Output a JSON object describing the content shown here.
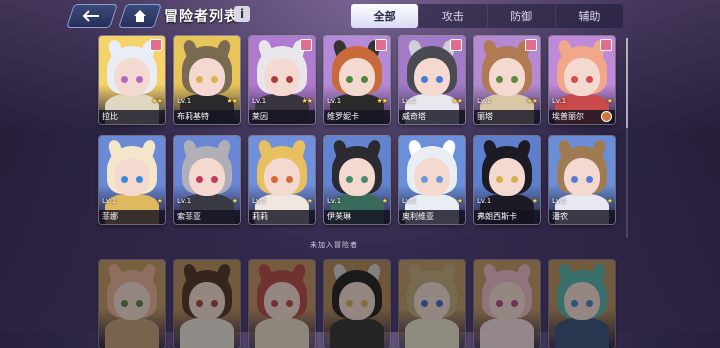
{
  "header": {
    "title": "冒险者列表",
    "info_label": "i"
  },
  "tabs": [
    {
      "label": "全部",
      "active": true
    },
    {
      "label": "攻击",
      "active": false
    },
    {
      "label": "防御",
      "active": false
    },
    {
      "label": "辅助",
      "active": false
    }
  ],
  "owned": [
    {
      "name": "拉比",
      "lv": "",
      "stars": "★★",
      "bg": "#f4d46a",
      "hair": "#e9eef6",
      "ear": "#e9eef6",
      "eye": "#b06ac0",
      "cloth": "#e0d8c0",
      "badge": true
    },
    {
      "name": "布莉基特",
      "lv": "Lv.1",
      "stars": "★★",
      "bg": "#e8c55a",
      "hair": "#7a6a52",
      "ear": "#7a6a52",
      "eye": "#d8b24a",
      "cloth": "#2a2a2a",
      "badge": false
    },
    {
      "name": "莱因",
      "lv": "Lv.1",
      "stars": "★★",
      "bg": "#b07ad0",
      "hair": "#e8e6ea",
      "ear": "#e8e6ea",
      "eye": "#b03a3a",
      "cloth": "#3a3440",
      "badge": true
    },
    {
      "name": "维罗妮卡",
      "lv": "Lv.1",
      "stars": "★★",
      "bg": "#b58ad8",
      "hair": "#c86a3a",
      "ear": "#333",
      "eye": "#4a8a3a",
      "cloth": "#2a2a2a",
      "badge": true
    },
    {
      "name": "威奇塔",
      "lv": "Lv.1",
      "stars": "★★",
      "bg": "#a27ac8",
      "hair": "#4a4a52",
      "ear": "#d0d0d8",
      "eye": "#4a7ad8",
      "cloth": "#e8e8ee",
      "badge": true
    },
    {
      "name": "丽塔",
      "lv": "Lv.1",
      "stars": "★★",
      "bg": "#b68ad2",
      "hair": "#b07a52",
      "ear": "#b07a52",
      "eye": "#5a8a3a",
      "cloth": "#d8c8a8",
      "badge": true
    },
    {
      "name": "埃普丽尔",
      "lv": "Lv.1",
      "stars": "★",
      "bg": "#c08ad8",
      "hair": "#f0a888",
      "ear": "#f0a888",
      "eye": "#d84a4a",
      "cloth": "#c84a4a",
      "badge": true
    },
    {
      "name": "菲娜",
      "lv": "Lv.1",
      "stars": "★",
      "bg": "#6a8ad8",
      "hair": "#f4e6c8",
      "ear": "#f4e6c8",
      "eye": "#3a8ad8",
      "cloth": "#e0b860",
      "badge": false
    },
    {
      "name": "索菲亚",
      "lv": "Lv.1",
      "stars": "★",
      "bg": "#6a86d4",
      "hair": "#b0aeb6",
      "ear": "#b0aeb6",
      "eye": "#c03a5a",
      "cloth": "#3a3a44",
      "badge": false
    },
    {
      "name": "莉莉",
      "lv": "Lv.1",
      "stars": "★",
      "bg": "#7090dc",
      "hair": "#e8c060",
      "ear": "#e8c060",
      "eye": "#d86a3a",
      "cloth": "#f0e8e0",
      "badge": false
    },
    {
      "name": "伊芙琳",
      "lv": "Lv.1",
      "stars": "★",
      "bg": "#6284d0",
      "hair": "#2a2a30",
      "ear": "#2a2a30",
      "eye": "#4a8a6a",
      "cloth": "#3a6a5a",
      "badge": false
    },
    {
      "name": "奥利维亚",
      "lv": "Lv.1",
      "stars": "★",
      "bg": "#6a90dc",
      "hair": "#eaeef4",
      "ear": "#ffffff",
      "eye": "#6a9ad8",
      "cloth": "#e8eef4",
      "badge": false
    },
    {
      "name": "弗朗西斯卡",
      "lv": "Lv.1",
      "stars": "★",
      "bg": "#5e80cc",
      "hair": "#1c1a22",
      "ear": "#1c1a22",
      "eye": "#d8b04a",
      "cloth": "#1c1a22",
      "badge": false
    },
    {
      "name": "潘农",
      "lv": "Lv.1",
      "stars": "★",
      "bg": "#6a8ed8",
      "hair": "#a07a52",
      "ear": "#a07a52",
      "eye": "#5a7ad8",
      "cloth": "#e8e8f0",
      "badge": false
    }
  ],
  "divider_label": "未加入冒险者",
  "unowned": [
    {
      "bg": "#c89a5a",
      "hair": "#f0b090",
      "ear": "#f0b090",
      "eye": "#5a8a3a",
      "cloth": "#c8a070"
    },
    {
      "bg": "#c0905a",
      "hair": "#5a3a2a",
      "ear": "#5a3a2a",
      "eye": "#b04a3a",
      "cloth": "#e8e0d8"
    },
    {
      "bg": "#c8925a",
      "hair": "#c84a4a",
      "ear": "#c84a4a",
      "eye": "#c84a4a",
      "cloth": "#e8d8c0"
    },
    {
      "bg": "#b88a52",
      "hair": "#2a2a2a",
      "ear": "#d0d0d0",
      "eye": "#d8b04a",
      "cloth": "#3a3a3a"
    },
    {
      "bg": "#c49a62",
      "hair": "#c8a878",
      "ear": "#c8a878",
      "eye": "#4a6ad8",
      "cloth": "#e8e0c8"
    },
    {
      "bg": "#c89a5e",
      "hair": "#f0b8c8",
      "ear": "#f0b8c8",
      "eye": "#c84a8a",
      "cloth": "#f0d8e0"
    },
    {
      "bg": "#c09058",
      "hair": "#4ab8b0",
      "ear": "#4ab8b0",
      "eye": "#3a8ad8",
      "cloth": "#3a5a8a"
    }
  ]
}
